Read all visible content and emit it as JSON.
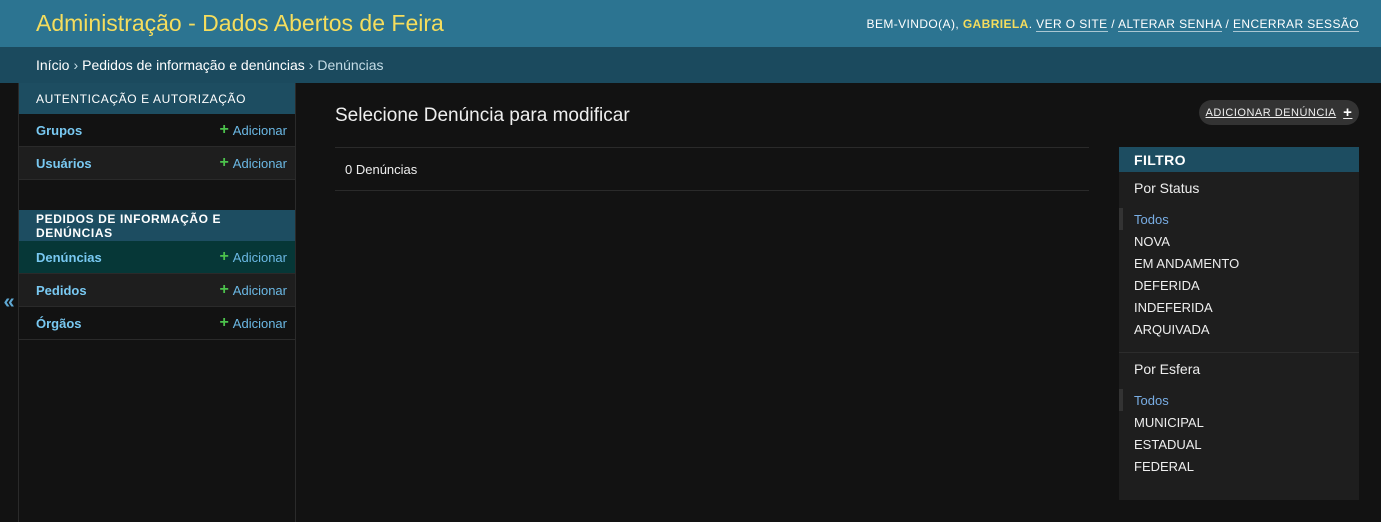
{
  "header": {
    "title": "Administração - Dados Abertos de Feira",
    "welcome": "BEM-VINDO(A), ",
    "username": "GABRIELA",
    "view_site": "VER O SITE",
    "change_password": "ALTERAR SENHA",
    "logout": "ENCERRAR SESSÃO",
    "separator": " / ",
    "period": ". "
  },
  "breadcrumbs": {
    "home": "Início",
    "app": "Pedidos de informação e denúncias",
    "current": "Denúncias",
    "separator": "›"
  },
  "sidebar": {
    "toggle": "«",
    "add_label": "Adicionar",
    "modules": [
      {
        "caption": "Autenticação e Autorização",
        "models": [
          {
            "name": "Grupos"
          },
          {
            "name": "Usuários"
          }
        ]
      },
      {
        "caption": "Pedidos de informação e denúncias",
        "models": [
          {
            "name": "Denúncias"
          },
          {
            "name": "Pedidos"
          },
          {
            "name": "Órgãos"
          }
        ]
      }
    ]
  },
  "main": {
    "title": "Selecione Denúncia para modificar",
    "add_button": "Adicionar Denúncia",
    "result_count": "0 Denúncias"
  },
  "filter": {
    "title": "FILTRO",
    "groups": [
      {
        "title": "Por Status",
        "options": [
          "Todos",
          "NOVA",
          "EM ANDAMENTO",
          "DEFERIDA",
          "INDEFERIDA",
          "ARQUIVADA"
        ]
      },
      {
        "title": "Por Esfera",
        "options": [
          "Todos",
          "MUNICIPAL",
          "ESTADUAL",
          "FEDERAL"
        ]
      }
    ]
  },
  "colors": {
    "header_bg": "#2c7491",
    "breadcrumb_bg": "#1b4a5e",
    "brand_yellow": "#f5dd5d",
    "link_blue": "#79c9f2",
    "add_green": "#4cc24c",
    "page_bg": "#121212"
  }
}
